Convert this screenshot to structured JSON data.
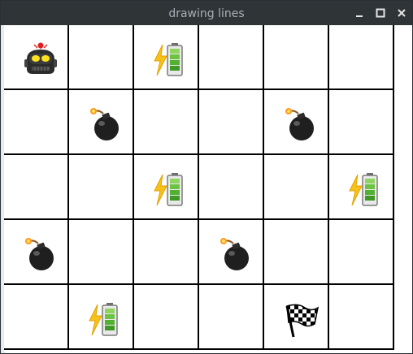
{
  "window": {
    "title": "drawing lines"
  },
  "board": {
    "rows": 5,
    "cols": 6,
    "cells": [
      [
        "robot",
        "",
        "battery",
        "",
        "",
        ""
      ],
      [
        "",
        "bomb",
        "",
        "",
        "bomb",
        ""
      ],
      [
        "",
        "",
        "battery",
        "",
        "",
        "battery"
      ],
      [
        "bomb",
        "",
        "",
        "bomb",
        "",
        ""
      ],
      [
        "",
        "battery",
        "",
        "",
        "flag",
        ""
      ]
    ]
  },
  "icons": {
    "robot": "robot-icon",
    "battery": "battery-icon",
    "bomb": "bomb-icon",
    "flag": "checkered-flag-icon"
  },
  "colors": {
    "titlebar": "#2f3437",
    "grid": "#000000",
    "battery_green": "#5cb83a",
    "bolt_yellow": "#f6c21a"
  }
}
